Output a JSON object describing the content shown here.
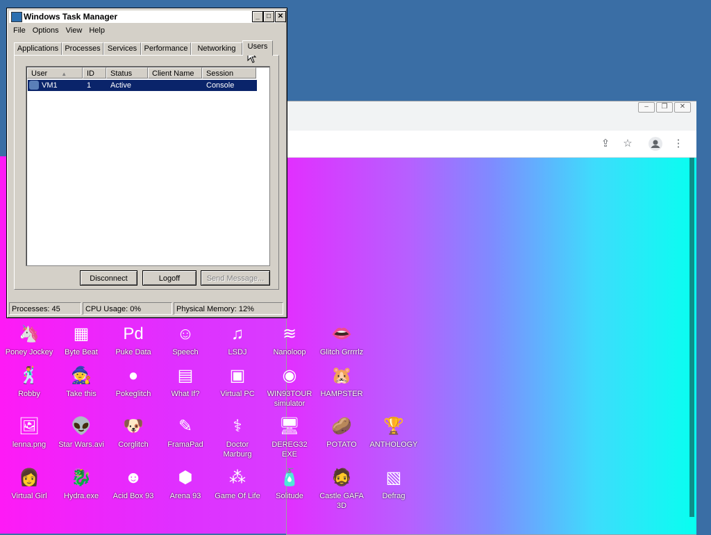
{
  "task_manager": {
    "title": "Windows Task Manager",
    "window_buttons": {
      "minimize": "_",
      "maximize": "□",
      "close": "✕"
    },
    "menu": [
      "File",
      "Options",
      "View",
      "Help"
    ],
    "tabs": [
      "Applications",
      "Processes",
      "Services",
      "Performance",
      "Networking",
      "Users"
    ],
    "active_tab": "Users",
    "columns": [
      "User",
      "ID",
      "Status",
      "Client Name",
      "Session"
    ],
    "rows": [
      {
        "user": "VM1",
        "id": "1",
        "status": "Active",
        "client_name": "",
        "session": "Console"
      }
    ],
    "buttons": {
      "disconnect": "Disconnect",
      "logoff": "Logoff",
      "send_message": "Send Message..."
    },
    "status": {
      "processes": "Processes: 45",
      "cpu": "CPU Usage: 0%",
      "memory": "Physical Memory: 12%"
    }
  },
  "browser": {
    "window_buttons": {
      "minimize": "‒",
      "restore": "❐",
      "close": "✕"
    },
    "toolbar_icons": [
      "share-icon",
      "star-icon",
      "profile-icon",
      "more-icon"
    ]
  },
  "desktop_icons": [
    {
      "label": "Poney Jockey",
      "icon": "pony-icon",
      "glyph": "🦄"
    },
    {
      "label": "Byte Beat",
      "icon": "bytebeat-icon",
      "glyph": "▦"
    },
    {
      "label": "Puke Data",
      "icon": "puredata-icon",
      "glyph": "Pd"
    },
    {
      "label": "Speech",
      "icon": "speech-face-icon",
      "glyph": "☺"
    },
    {
      "label": "LSDJ",
      "icon": "lsdj-icon",
      "glyph": "♫"
    },
    {
      "label": "Nanoloop",
      "icon": "nanoloop-icon",
      "glyph": "≋"
    },
    {
      "label": "Glitch Grrrrlz",
      "icon": "lips-icon",
      "glyph": "👄"
    },
    {
      "label": "Robby",
      "icon": "stick-figure-icon",
      "glyph": "🕺"
    },
    {
      "label": "Take this",
      "icon": "take-this-icon",
      "glyph": "🧙"
    },
    {
      "label": "Pokeglitch",
      "icon": "pokeglitch-icon",
      "glyph": "●"
    },
    {
      "label": "What If?",
      "icon": "what-if-icon",
      "glyph": "▤"
    },
    {
      "label": "Virtual PC",
      "icon": "virtual-pc-icon",
      "glyph": "▣"
    },
    {
      "label": "WIN93TOUR simulator",
      "icon": "tour-icon",
      "glyph": "◉"
    },
    {
      "label": "HAMPSTER",
      "icon": "hamster-icon",
      "glyph": "🐹"
    },
    {
      "label": "lenna.png",
      "icon": "image-file-icon",
      "glyph": "🖼"
    },
    {
      "label": "Star Wars.avi",
      "icon": "yoda-icon",
      "glyph": "👽"
    },
    {
      "label": "Corglitch",
      "icon": "corgi-icon",
      "glyph": "🐶"
    },
    {
      "label": "FramaPad",
      "icon": "framapad-icon",
      "glyph": "✎"
    },
    {
      "label": "Doctor Marburg",
      "icon": "doctor-icon",
      "glyph": "⚕"
    },
    {
      "label": "DEREG32 EXE",
      "icon": "dereg-icon",
      "glyph": "🖥"
    },
    {
      "label": "POTATO",
      "icon": "potato-icon",
      "glyph": "🥔"
    },
    {
      "label": "ANTHOLOGY",
      "icon": "trophy-icon",
      "glyph": "🏆"
    },
    {
      "label": "Virtual Girl",
      "icon": "virtual-girl-icon",
      "glyph": "👩"
    },
    {
      "label": "Hydra.exe",
      "icon": "hydra-icon",
      "glyph": "🐉"
    },
    {
      "label": "Acid Box 93",
      "icon": "smiley-icon",
      "glyph": "☻"
    },
    {
      "label": "Arena 93",
      "icon": "cube-icon",
      "glyph": "⬢"
    },
    {
      "label": "Game Of Life",
      "icon": "game-of-life-icon",
      "glyph": "⁂"
    },
    {
      "label": "Solitude",
      "icon": "solitude-icon",
      "glyph": "🧴"
    },
    {
      "label": "Castle GAFA 3D",
      "icon": "castle-icon",
      "glyph": "🧔"
    },
    {
      "label": "Defrag",
      "icon": "defrag-icon",
      "glyph": "▧"
    }
  ]
}
